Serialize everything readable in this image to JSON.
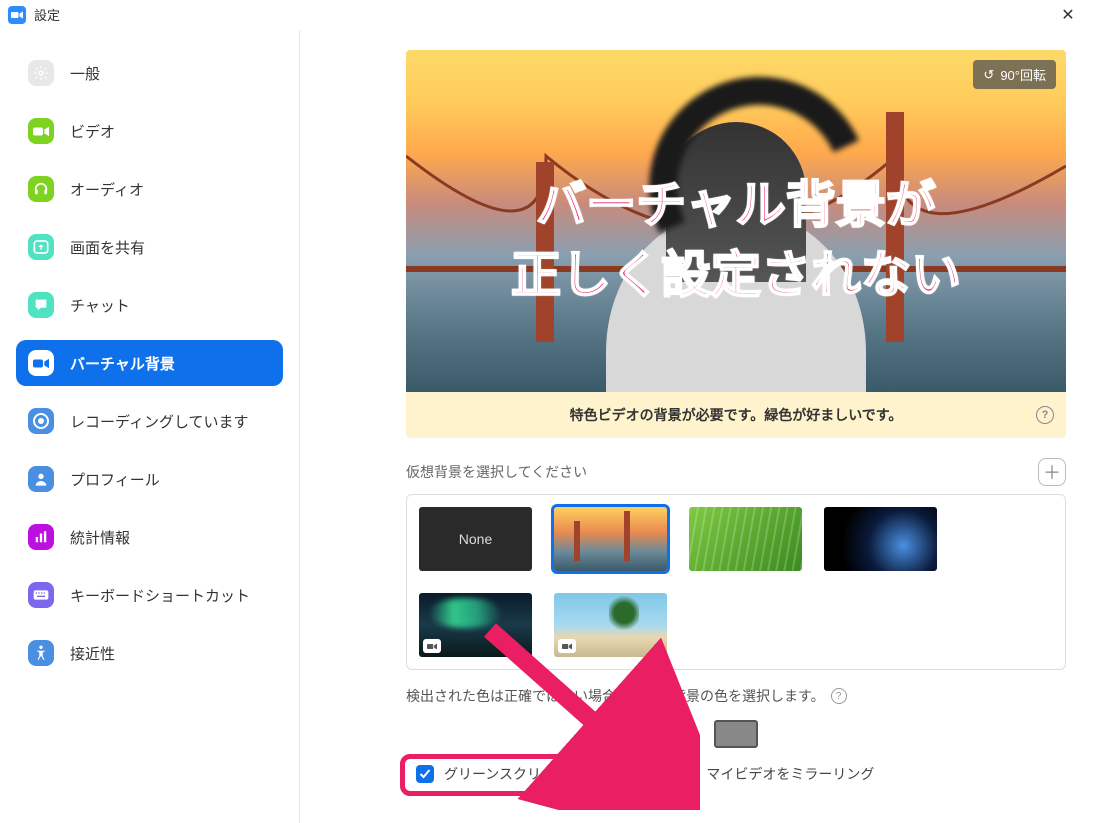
{
  "titlebar": {
    "title": "設定"
  },
  "sidebar": {
    "items": [
      {
        "label": "一般"
      },
      {
        "label": "ビデオ"
      },
      {
        "label": "オーディオ"
      },
      {
        "label": "画面を共有"
      },
      {
        "label": "チャット"
      },
      {
        "label": "バーチャル背景"
      },
      {
        "label": "レコーディングしています"
      },
      {
        "label": "プロフィール"
      },
      {
        "label": "統計情報"
      },
      {
        "label": "キーボードショートカット"
      },
      {
        "label": "接近性"
      }
    ]
  },
  "preview": {
    "rotate_label": "90°回転",
    "overlay_line1": "バーチャル背景が",
    "overlay_line2": "正しく設定されない",
    "warning": "特色ビデオの背景が必要です。緑色が好ましいです。"
  },
  "section": {
    "choose_label": "仮想背景を選択してください",
    "none_label": "None",
    "detect_text": "検出された色は正確ではない場合、手動で背景の色を選択します。",
    "green_screen_label": "グリーンスクリーンがあります",
    "mirror_label": "マイビデオをミラーリング"
  }
}
